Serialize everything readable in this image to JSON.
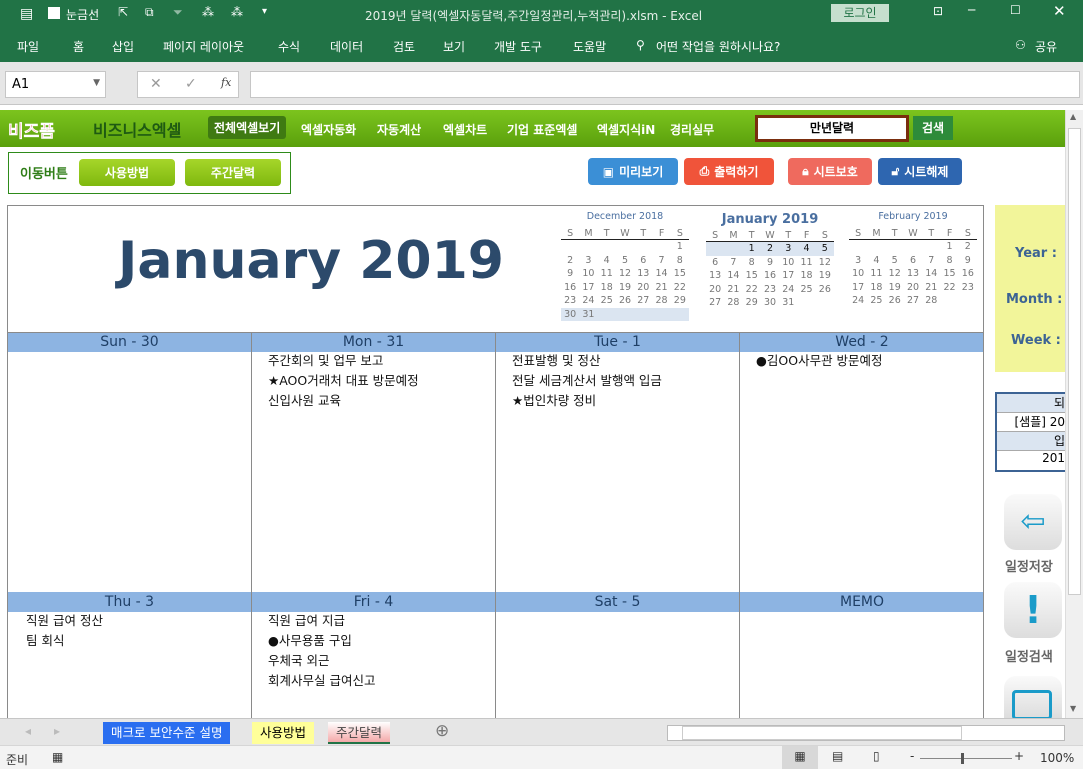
{
  "titlebar": {
    "gridlines_label": "눈금선",
    "title": "2019년 달력(엑셀자동달력,주간일정관리,누적관리).xlsm  -  Excel",
    "login": "로그인"
  },
  "ribbon": {
    "tabs": [
      "파일",
      "홈",
      "삽입",
      "페이지 레이아웃",
      "수식",
      "데이터",
      "검토",
      "보기",
      "개발 도구",
      "도움말"
    ],
    "search": "어떤 작업을 원하시나요?",
    "share": "공유"
  },
  "formula": {
    "namebox": "A1",
    "fx": "fx",
    "value": ""
  },
  "banner": {
    "logo1": "비즈폼",
    "logo2": "비즈니스엑셀",
    "nav": [
      "전체엑셀보기",
      "엑셀자동화",
      "자동계산",
      "엑셀차트",
      "기업 표준엑셀",
      "엑셀지식iN",
      "경리실무"
    ],
    "search_value": "만년달력",
    "search_btn": "검색"
  },
  "movebox": {
    "label": "이동버튼",
    "buttons": [
      "사용방법",
      "주간달력"
    ]
  },
  "actions": [
    {
      "label": "미리보기",
      "color": "#3b8fd6"
    },
    {
      "label": "출력하기",
      "color": "#f0543a"
    },
    {
      "label": "시트보호",
      "color": "#ef6a5e"
    },
    {
      "label": "시트해제",
      "color": "#2e66b0"
    }
  ],
  "calendar": {
    "title": "January 2019",
    "minis": [
      {
        "title": "December 2018",
        "dow": [
          "S",
          "M",
          "T",
          "W",
          "T",
          "F",
          "S"
        ],
        "weeks": [
          [
            "",
            "",
            "",
            "",
            "",
            "",
            "1"
          ],
          [
            "2",
            "3",
            "4",
            "5",
            "6",
            "7",
            "8"
          ],
          [
            "9",
            "10",
            "11",
            "12",
            "13",
            "14",
            "15"
          ],
          [
            "16",
            "17",
            "18",
            "19",
            "20",
            "21",
            "22"
          ],
          [
            "23",
            "24",
            "25",
            "26",
            "27",
            "28",
            "29"
          ],
          [
            "30",
            "31",
            "",
            "",
            "",
            "",
            ""
          ]
        ],
        "highlight_week": 5
      },
      {
        "title": "January 2019",
        "dow": [
          "S",
          "M",
          "T",
          "W",
          "T",
          "F",
          "S"
        ],
        "weeks": [
          [
            "",
            "",
            "1",
            "2",
            "3",
            "4",
            "5"
          ],
          [
            "6",
            "7",
            "8",
            "9",
            "10",
            "11",
            "12"
          ],
          [
            "13",
            "14",
            "15",
            "16",
            "17",
            "18",
            "19"
          ],
          [
            "20",
            "21",
            "22",
            "23",
            "24",
            "25",
            "26"
          ],
          [
            "27",
            "28",
            "29",
            "30",
            "31",
            "",
            ""
          ]
        ],
        "highlight_week": 0
      },
      {
        "title": "February 2019",
        "dow": [
          "S",
          "M",
          "T",
          "W",
          "T",
          "F",
          "S"
        ],
        "weeks": [
          [
            "",
            "",
            "",
            "",
            "",
            "1",
            "2"
          ],
          [
            "3",
            "4",
            "5",
            "6",
            "7",
            "8",
            "9"
          ],
          [
            "10",
            "11",
            "12",
            "13",
            "14",
            "15",
            "16"
          ],
          [
            "17",
            "18",
            "19",
            "20",
            "21",
            "22",
            "23"
          ],
          [
            "24",
            "25",
            "26",
            "27",
            "28",
            "",
            ""
          ]
        ],
        "highlight_week": -1
      }
    ],
    "days": [
      {
        "header": "Sun - 30",
        "events": []
      },
      {
        "header": "Mon - 31",
        "events": [
          "주간회의 및 업무 보고",
          "★AOO거래처 대표 방문예정",
          "신입사원 교육"
        ]
      },
      {
        "header": "Tue - 1",
        "events": [
          "전표발행 및 정산",
          "전달 세금계산서 발행액 입금",
          "★법인차량 정비"
        ]
      },
      {
        "header": "Wed - 2",
        "events": [
          "●김OO사무관 방문예정"
        ]
      },
      {
        "header": "Thu - 3",
        "events": [
          "직원 급여 정산",
          "팀 회식"
        ]
      },
      {
        "header": "Fri - 4",
        "events": [
          "직원 급여 지급",
          "●사무용품 구입",
          "우체국 외근",
          "회계사무실 급여신고"
        ]
      },
      {
        "header": "Sat - 5",
        "events": []
      },
      {
        "header": "MEMO",
        "events": []
      }
    ]
  },
  "side": {
    "labels": [
      "Year :",
      "Month :",
      "Week :"
    ],
    "table": [
      "되",
      "[샘플] 20",
      "입",
      "201"
    ],
    "icons": [
      "일정저장",
      "일정검색"
    ]
  },
  "sheets": [
    "매크로 보안수준 설명",
    "사용방법",
    "주간달력"
  ],
  "status": {
    "ready": "준비",
    "zoom": "100%"
  }
}
